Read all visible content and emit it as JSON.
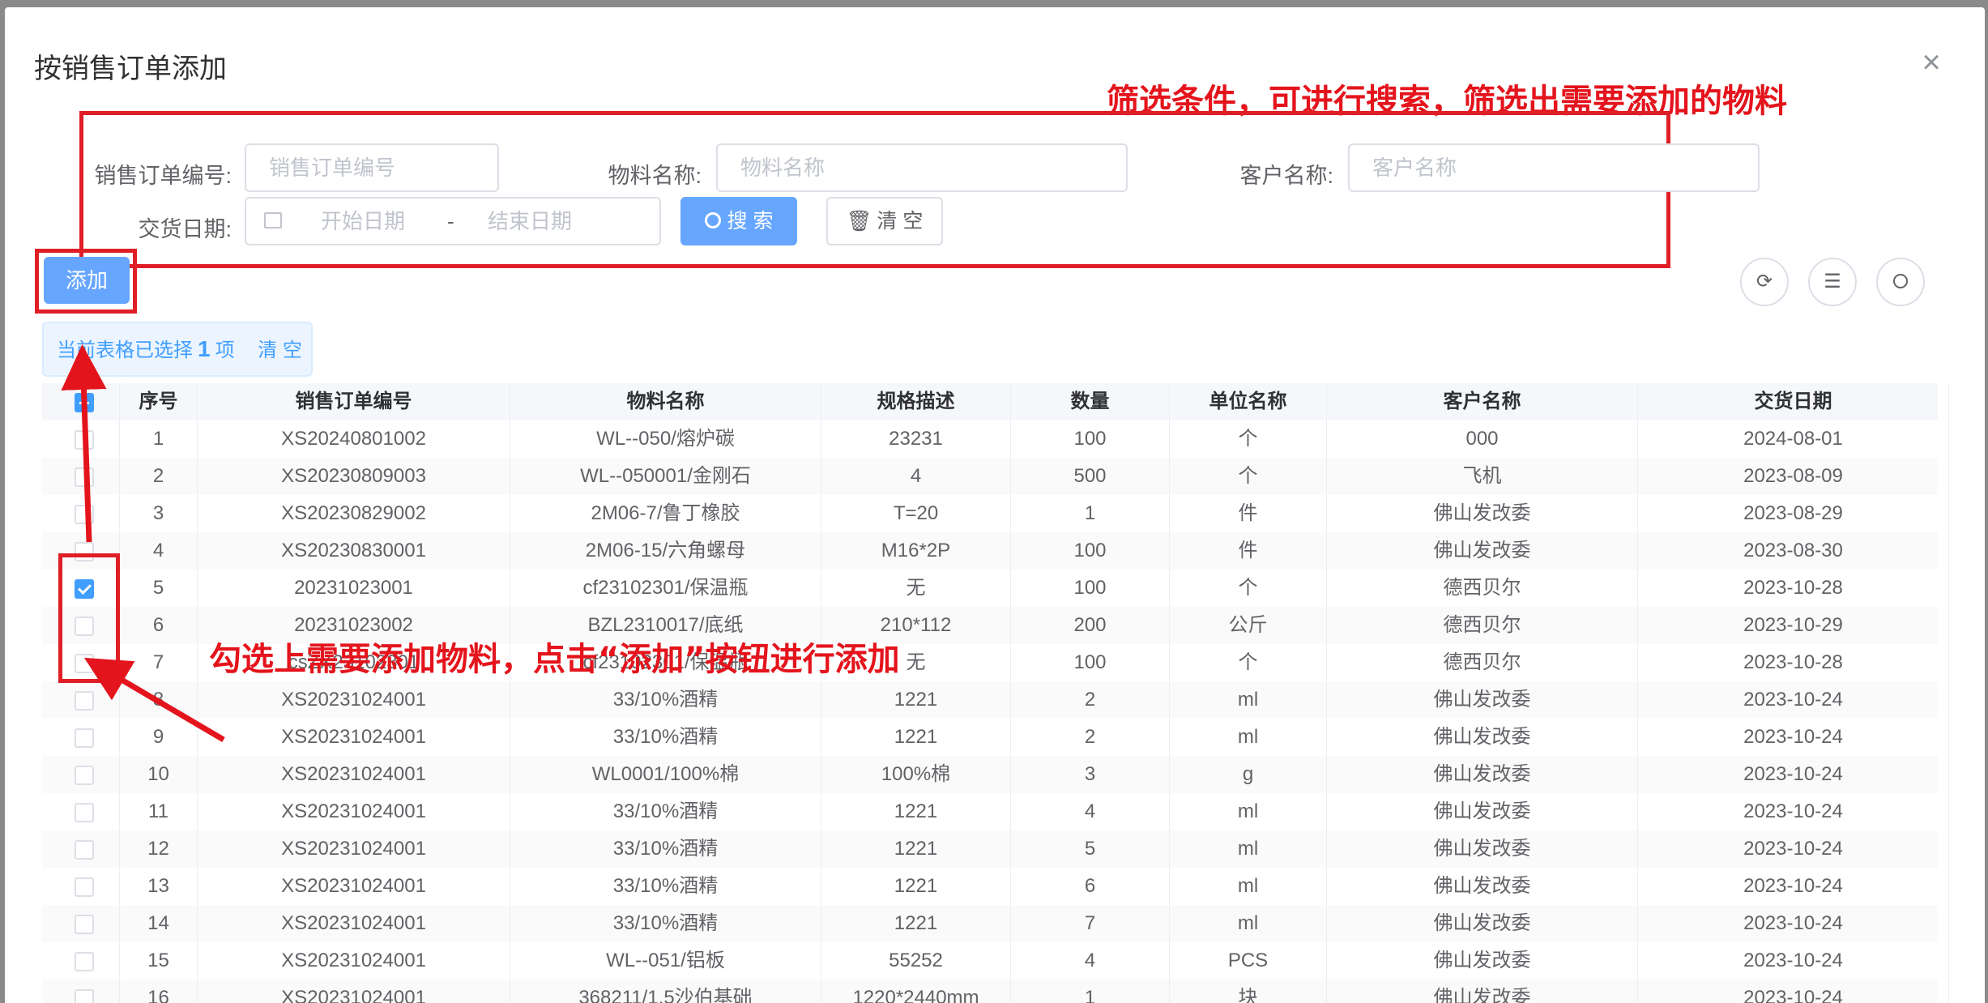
{
  "dialog": {
    "title": "按销售订单添加",
    "close_icon": "close-icon"
  },
  "annotations": {
    "filter_note": "筛选条件，可进行搜索，筛选出需要添加的物料",
    "select_note": "勾选上需要添加物料，点击“添加”按钮进行添加"
  },
  "filters": {
    "order_no_label": "销售订单编号:",
    "order_no_placeholder": "销售订单编号",
    "material_label": "物料名称:",
    "material_placeholder": "物料名称",
    "customer_label": "客户名称:",
    "customer_placeholder": "客户名称",
    "date_label": "交货日期:",
    "start_placeholder": "开始日期",
    "range_sep": "-",
    "end_placeholder": "结束日期",
    "search_label": "搜 索",
    "clear_label": "清 空"
  },
  "toolbar": {
    "add_label": "添加",
    "refresh_icon": "refresh-icon",
    "columns_icon": "sliders-icon",
    "search_icon": "search-icon"
  },
  "selection": {
    "prefix": "当前表格已选择",
    "count": "1",
    "suffix": "项",
    "clear": "清 空"
  },
  "table": {
    "columns": [
      "",
      "序号",
      "销售订单编号",
      "物料名称",
      "规格描述",
      "数量",
      "单位名称",
      "客户名称",
      "交货日期"
    ],
    "rows": [
      {
        "checked": false,
        "cells": [
          "1",
          "XS20240801002",
          "WL--050/熔炉碳",
          "23231",
          "100",
          "个",
          "000",
          "2024-08-01"
        ]
      },
      {
        "checked": false,
        "cells": [
          "2",
          "XS20230809003",
          "WL--050001/金刚石",
          "4",
          "500",
          "个",
          "飞机",
          "2023-08-09"
        ]
      },
      {
        "checked": false,
        "cells": [
          "3",
          "XS20230829002",
          "2M06-7/鲁丁橡胶",
          "T=20",
          "1",
          "件",
          "佛山发改委",
          "2023-08-29"
        ]
      },
      {
        "checked": false,
        "cells": [
          "4",
          "XS20230830001",
          "2M06-15/六角螺母",
          "M16*2P",
          "100",
          "件",
          "佛山发改委",
          "2023-08-30"
        ]
      },
      {
        "checked": true,
        "cells": [
          "5",
          "20231023001",
          "cf23102301/保温瓶",
          "无",
          "100",
          "个",
          "德西贝尔",
          "2023-10-28"
        ]
      },
      {
        "checked": false,
        "cells": [
          "6",
          "20231023002",
          "BZL2310017/底纸",
          "210*112",
          "200",
          "公斤",
          "德西贝尔",
          "2023-10-29"
        ]
      },
      {
        "checked": false,
        "cells": [
          "7",
          "csZX23102301",
          "cf23102301/保温瓶",
          "无",
          "100",
          "个",
          "德西贝尔",
          "2023-10-28"
        ]
      },
      {
        "checked": false,
        "cells": [
          "8",
          "XS20231024001",
          "33/10%酒精",
          "1221",
          "2",
          "ml",
          "佛山发改委",
          "2023-10-24"
        ]
      },
      {
        "checked": false,
        "cells": [
          "9",
          "XS20231024001",
          "33/10%酒精",
          "1221",
          "2",
          "ml",
          "佛山发改委",
          "2023-10-24"
        ]
      },
      {
        "checked": false,
        "cells": [
          "10",
          "XS20231024001",
          "WL0001/100%棉",
          "100%棉",
          "3",
          "g",
          "佛山发改委",
          "2023-10-24"
        ]
      },
      {
        "checked": false,
        "cells": [
          "11",
          "XS20231024001",
          "33/10%酒精",
          "1221",
          "4",
          "ml",
          "佛山发改委",
          "2023-10-24"
        ]
      },
      {
        "checked": false,
        "cells": [
          "12",
          "XS20231024001",
          "33/10%酒精",
          "1221",
          "5",
          "ml",
          "佛山发改委",
          "2023-10-24"
        ]
      },
      {
        "checked": false,
        "cells": [
          "13",
          "XS20231024001",
          "33/10%酒精",
          "1221",
          "6",
          "ml",
          "佛山发改委",
          "2023-10-24"
        ]
      },
      {
        "checked": false,
        "cells": [
          "14",
          "XS20231024001",
          "33/10%酒精",
          "1221",
          "7",
          "ml",
          "佛山发改委",
          "2023-10-24"
        ]
      },
      {
        "checked": false,
        "cells": [
          "15",
          "XS20231024001",
          "WL--051/铝板",
          "55252",
          "4",
          "PCS",
          "佛山发改委",
          "2023-10-24"
        ]
      },
      {
        "checked": false,
        "cells": [
          "16",
          "XS20231024001",
          "368211/1.5沙伯基础",
          "1220*2440mm",
          "1",
          "块",
          "佛山发改委",
          "2023-10-24"
        ]
      }
    ]
  },
  "colors": {
    "primary": "#409eff",
    "primary_light": "#66a6ff",
    "annotation_red": "#e4141c"
  }
}
